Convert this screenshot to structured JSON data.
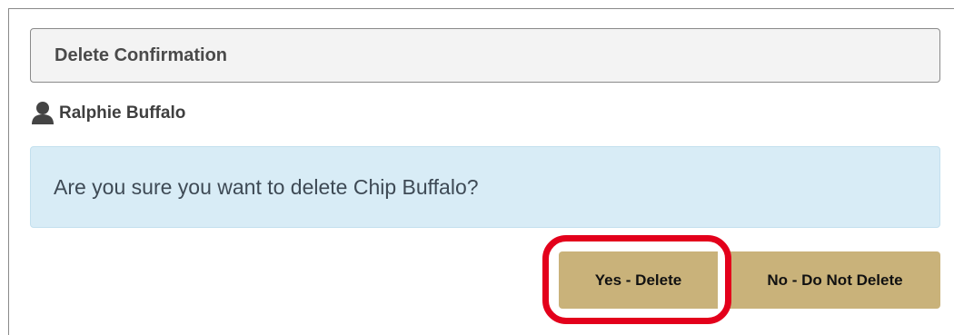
{
  "colors": {
    "button_bg": "#c9b27a",
    "alert_bg": "#d8ecf6",
    "highlight": "#e3001b",
    "heading_bg": "#f3f3f3"
  },
  "panel": {
    "title": "Delete Confirmation"
  },
  "user": {
    "icon": "user-icon",
    "name": "Ralphie Buffalo"
  },
  "alert": {
    "message": "Are you sure you want to delete Chip Buffalo?"
  },
  "actions": {
    "confirm_label": "Yes - Delete",
    "cancel_label": "No - Do Not Delete"
  }
}
